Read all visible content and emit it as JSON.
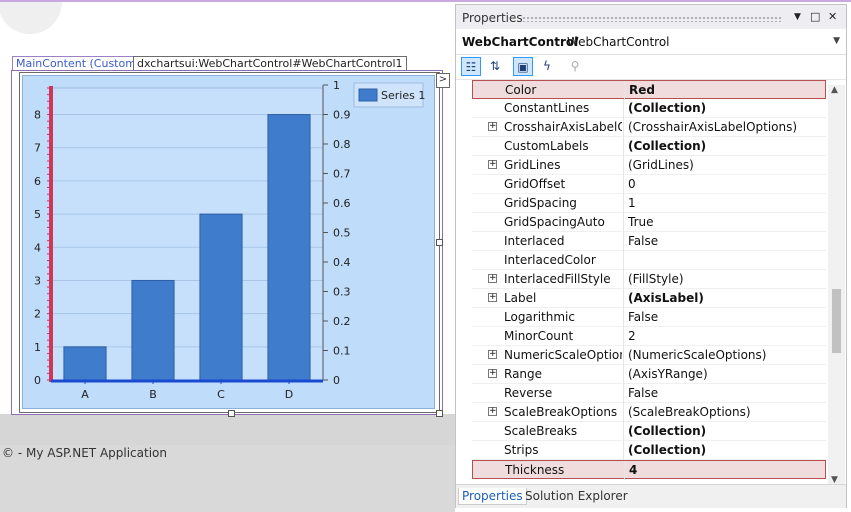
{
  "designer": {
    "tag_main": "MainContent (Custom)",
    "tag_control": "dxchartsui:WebChartControl#WebChartControl1",
    "footer_text": "© - My ASP.NET Application",
    "expand_glyph": ">"
  },
  "chart_data": {
    "type": "bar",
    "categories": [
      "A",
      "B",
      "C",
      "D"
    ],
    "series": [
      {
        "name": "Series 1",
        "values": [
          1,
          3,
          5,
          8
        ]
      }
    ],
    "y_ticks": [
      "0",
      "1",
      "2",
      "3",
      "4",
      "5",
      "6",
      "7",
      "8"
    ],
    "y2_ticks": [
      "0",
      "0.1",
      "0.2",
      "0.3",
      "0.4",
      "0.5",
      "0.6",
      "0.7",
      "0.8",
      "0.9",
      "1"
    ],
    "ylim": [
      0,
      8.8
    ],
    "y2lim": [
      0,
      1
    ],
    "legend_position": "top-right",
    "colors": {
      "bar": "#3f7ccc",
      "bar_edge": "#2f5fa8",
      "axis_y": "#d2355a",
      "axis_x": "#1a4ad0",
      "background": "#bfdcfa",
      "gridline": "#a8c5e6"
    }
  },
  "properties": {
    "title": "Properties",
    "selected_object": "WebChartControl",
    "selected_type": "WebChartControl",
    "tabs": [
      "Properties",
      "Solution Explorer"
    ],
    "toolbar_icons": [
      "categorized-icon",
      "alphabetical-icon",
      "properties-icon",
      "events-icon",
      "property-pages-icon"
    ],
    "rows": [
      {
        "name": "Color",
        "value": "Red",
        "bold": true,
        "expandable": false,
        "selected": true
      },
      {
        "name": "ConstantLines",
        "value": "(Collection)",
        "bold": true,
        "expandable": false,
        "selected": false
      },
      {
        "name": "CrosshairAxisLabelOpt",
        "value": "(CrosshairAxisLabelOptions)",
        "bold": false,
        "expandable": true,
        "selected": false
      },
      {
        "name": "CustomLabels",
        "value": "(Collection)",
        "bold": true,
        "expandable": false,
        "selected": false
      },
      {
        "name": "GridLines",
        "value": "(GridLines)",
        "bold": false,
        "expandable": true,
        "selected": false
      },
      {
        "name": "GridOffset",
        "value": "0",
        "bold": false,
        "expandable": false,
        "selected": false
      },
      {
        "name": "GridSpacing",
        "value": "1",
        "bold": false,
        "expandable": false,
        "selected": false
      },
      {
        "name": "GridSpacingAuto",
        "value": "True",
        "bold": false,
        "expandable": false,
        "selected": false
      },
      {
        "name": "Interlaced",
        "value": "False",
        "bold": false,
        "expandable": false,
        "selected": false
      },
      {
        "name": "InterlacedColor",
        "value": "",
        "bold": false,
        "expandable": false,
        "selected": false
      },
      {
        "name": "InterlacedFillStyle",
        "value": "(FillStyle)",
        "bold": false,
        "expandable": true,
        "selected": false
      },
      {
        "name": "Label",
        "value": "(AxisLabel)",
        "bold": true,
        "expandable": true,
        "selected": false
      },
      {
        "name": "Logarithmic",
        "value": "False",
        "bold": false,
        "expandable": false,
        "selected": false
      },
      {
        "name": "MinorCount",
        "value": "2",
        "bold": false,
        "expandable": false,
        "selected": false
      },
      {
        "name": "NumericScaleOptions",
        "value": "(NumericScaleOptions)",
        "bold": false,
        "expandable": true,
        "selected": false
      },
      {
        "name": "Range",
        "value": "(AxisYRange)",
        "bold": false,
        "expandable": true,
        "selected": false
      },
      {
        "name": "Reverse",
        "value": "False",
        "bold": false,
        "expandable": false,
        "selected": false
      },
      {
        "name": "ScaleBreakOptions",
        "value": "(ScaleBreakOptions)",
        "bold": false,
        "expandable": true,
        "selected": false
      },
      {
        "name": "ScaleBreaks",
        "value": "(Collection)",
        "bold": true,
        "expandable": false,
        "selected": false
      },
      {
        "name": "Strips",
        "value": "(Collection)",
        "bold": true,
        "expandable": false,
        "selected": false
      },
      {
        "name": "Thickness",
        "value": "4",
        "bold": true,
        "expandable": false,
        "selected": true
      }
    ]
  }
}
